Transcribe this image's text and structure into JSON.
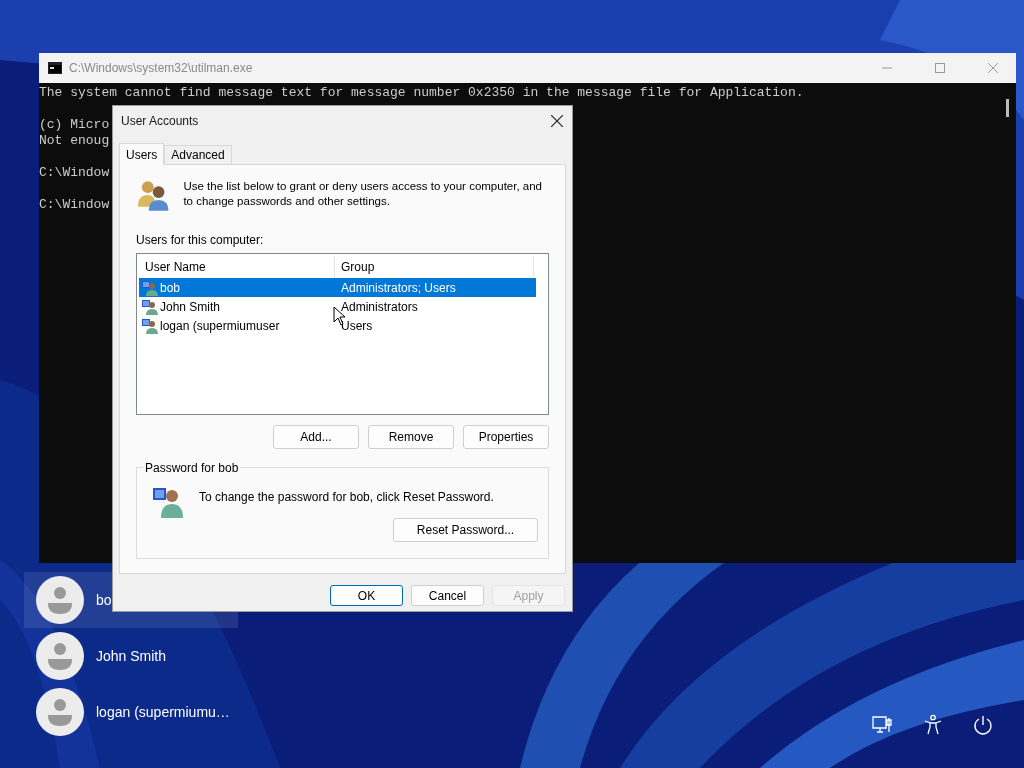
{
  "console_window": {
    "title": "C:\\Windows\\system32\\utilman.exe",
    "blocks": [
      [
        "The system cannot find message text for message number 0x2350 in the message file for Application."
      ],
      [
        "(c) Micro",
        "Not enoug"
      ],
      [
        "C:\\Window"
      ],
      [
        "C:\\Window"
      ]
    ]
  },
  "lock_screen": {
    "users": [
      {
        "name": "bo",
        "selected": true
      },
      {
        "name": "John Smith",
        "selected": false
      },
      {
        "name": "logan (supermiumu…",
        "selected": false
      }
    ]
  },
  "dialog": {
    "title": "User Accounts",
    "tabs": [
      {
        "label": "Users",
        "selected": true
      },
      {
        "label": "Advanced",
        "selected": false
      }
    ],
    "intro": "Use the list below to grant or deny users access to your computer, and to change passwords and other settings.",
    "list_label": "Users for this computer:",
    "table": {
      "columns": [
        "User Name",
        "Group"
      ],
      "rows": [
        {
          "user_name": "bob",
          "group": "Administrators; Users",
          "selected": true
        },
        {
          "user_name": "John Smith",
          "group": "Administrators",
          "selected": false
        },
        {
          "user_name": "logan (supermiumuser",
          "group": "Users",
          "selected": false
        }
      ]
    },
    "list_buttons": [
      "Add...",
      "Remove",
      "Properties"
    ],
    "password_group": {
      "title": "Password for bob",
      "text": "To change the password for bob, click Reset Password.",
      "button": "Reset Password..."
    },
    "footer_buttons": [
      {
        "label": "OK",
        "default": true,
        "disabled": false
      },
      {
        "label": "Cancel",
        "default": false,
        "disabled": false
      },
      {
        "label": "Apply",
        "default": false,
        "disabled": true
      }
    ]
  }
}
